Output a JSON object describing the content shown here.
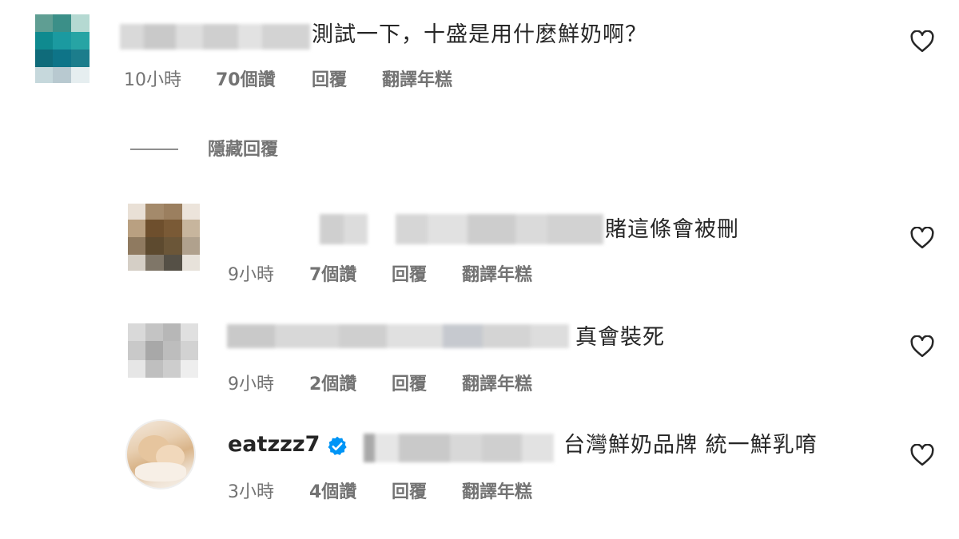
{
  "comments": [
    {
      "text": "測試一下，十盛是用什麼鮮奶啊？",
      "time": "10小時",
      "likes": "70個讚",
      "reply": "回覆",
      "translate": "翻譯年糕"
    }
  ],
  "hide_replies": "隱藏回覆",
  "replies": [
    {
      "text": "賭這條會被刪",
      "time": "9小時",
      "likes": "7個讚",
      "reply": "回覆",
      "translate": "翻譯年糕"
    },
    {
      "text": "真會裝死",
      "time": "9小時",
      "likes": "2個讚",
      "reply": "回覆",
      "translate": "翻譯年糕"
    },
    {
      "username": "eatzzz7",
      "verified": true,
      "text": "台灣鮮奶品牌 統一鮮乳唷",
      "time": "3小時",
      "likes": "4個讚",
      "reply": "回覆",
      "translate": "翻譯年糕"
    }
  ],
  "icons": {
    "like": "heart-outline-icon",
    "verified": "verified-badge-icon"
  },
  "colors": {
    "verified": "#0095f6",
    "meta": "#737373",
    "text": "#262626"
  }
}
